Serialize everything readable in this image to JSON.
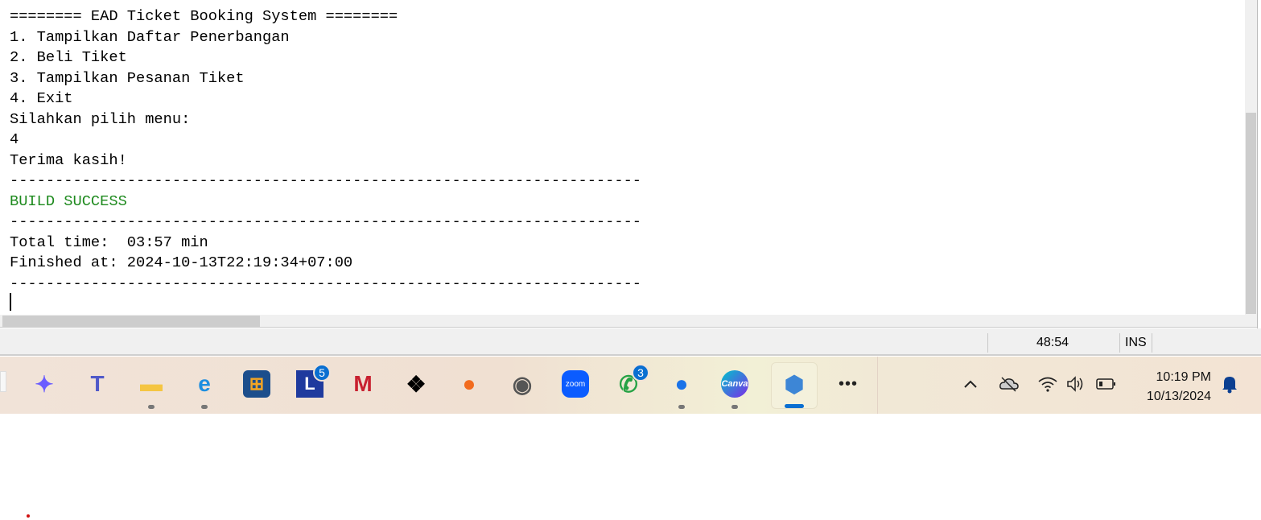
{
  "console": {
    "lines": [
      "======== EAD Ticket Booking System ========",
      "1. Tampilkan Daftar Penerbangan",
      "2. Beli Tiket",
      "3. Tampilkan Pesanan Tiket",
      "4. Exit",
      "Silahkan pilih menu:",
      "4",
      "Terima kasih!",
      "----------------------------------------------------------------------",
      "BUILD SUCCESS",
      "----------------------------------------------------------------------",
      "Total time:  03:57 min",
      "Finished at: 2024-10-13T22:19:34+07:00",
      "----------------------------------------------------------------------"
    ],
    "success_color": "#1e8a1e"
  },
  "status_bar": {
    "position": "48:54",
    "mode": "INS"
  },
  "taskbar": {
    "apps": [
      {
        "name": "copilot-icon",
        "running": false
      },
      {
        "name": "teams-icon",
        "running": false
      },
      {
        "name": "file-explorer-icon",
        "running": true
      },
      {
        "name": "edge-icon",
        "running": true
      },
      {
        "name": "microsoft-store-icon",
        "running": false
      },
      {
        "name": "l-app-icon",
        "badge": "5",
        "running": false
      },
      {
        "name": "mcafee-icon",
        "running": false
      },
      {
        "name": "dropbox-icon",
        "running": false
      },
      {
        "name": "firefox-icon",
        "running": false
      },
      {
        "name": "camera-icon",
        "running": false
      },
      {
        "name": "zoom-icon",
        "label": "zoom",
        "running": false
      },
      {
        "name": "whatsapp-icon",
        "badge": "3",
        "running": false
      },
      {
        "name": "chrome-icon",
        "running": true
      },
      {
        "name": "canva-icon",
        "label": "Canva",
        "running": true
      },
      {
        "name": "netbeans-icon",
        "running": true,
        "active": true
      }
    ],
    "clock": {
      "time": "10:19 PM",
      "date": "10/13/2024"
    }
  }
}
